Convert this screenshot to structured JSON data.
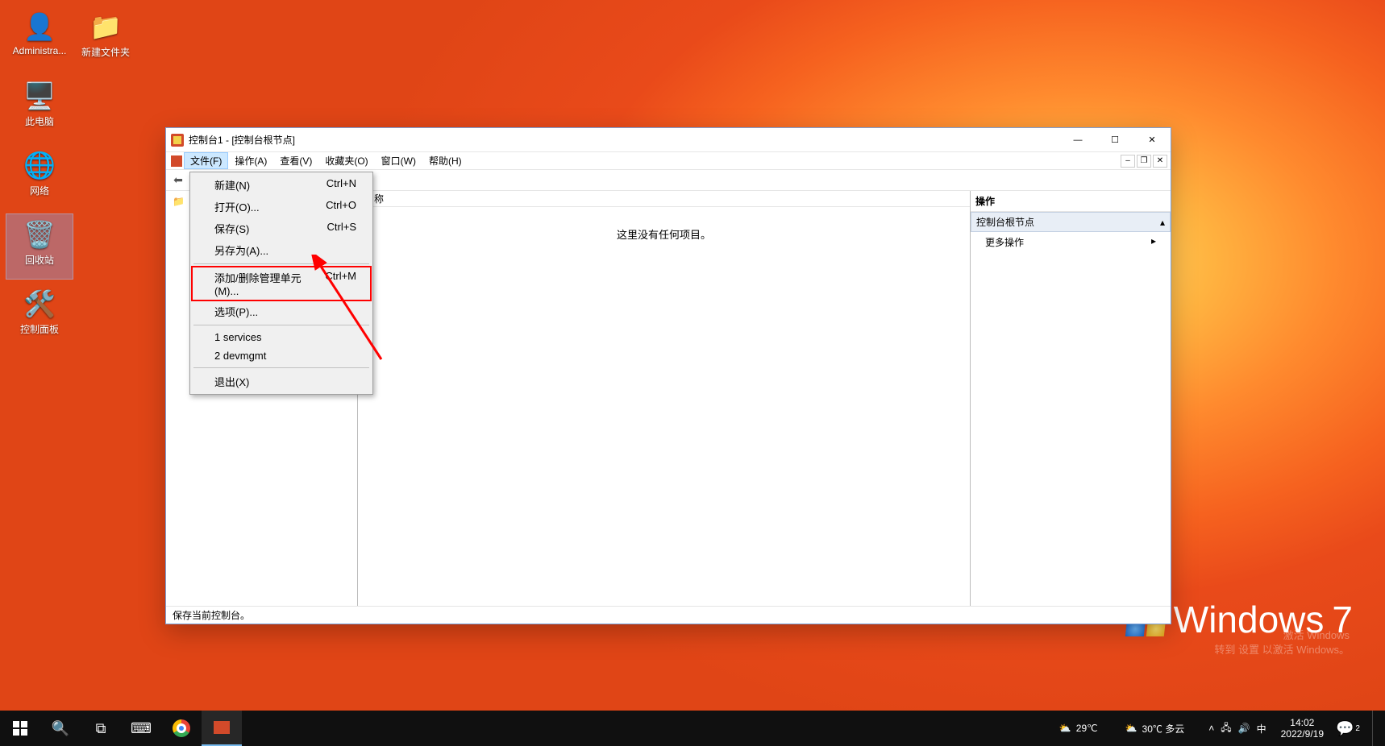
{
  "desktop_icons": {
    "administrator": "Administra...",
    "new_folder": "新建文件夹",
    "this_pc": "此电脑",
    "network": "网络",
    "recycle": "回收站",
    "control_panel": "控制面板"
  },
  "brand": {
    "name": "Windows",
    "ver": "7"
  },
  "watermark": {
    "l1": "激活 Windows",
    "l2": "转到 设置 以激活 Windows。"
  },
  "window": {
    "title": "控制台1 - [控制台根节点]",
    "menus": {
      "file": "文件(F)",
      "action": "操作(A)",
      "view": "查看(V)",
      "fav": "收藏夹(O)",
      "window": "窗口(W)",
      "help": "帮助(H)"
    },
    "content_header": "名称",
    "content_empty": "这里没有任何项目。",
    "actions": {
      "title": "操作",
      "section": "控制台根节点",
      "more": "更多操作"
    },
    "status": "保存当前控制台。"
  },
  "dropdown": {
    "new": {
      "label": "新建(N)",
      "accel": "Ctrl+N"
    },
    "open": {
      "label": "打开(O)...",
      "accel": "Ctrl+O"
    },
    "save": {
      "label": "保存(S)",
      "accel": "Ctrl+S"
    },
    "saveas": {
      "label": "另存为(A)...",
      "accel": ""
    },
    "snapin": {
      "label": "添加/删除管理单元(M)...",
      "accel": "Ctrl+M"
    },
    "options": {
      "label": "选项(P)...",
      "accel": ""
    },
    "recent1": {
      "label": "1 services",
      "accel": ""
    },
    "recent2": {
      "label": "2 devmgmt",
      "accel": ""
    },
    "exit": {
      "label": "退出(X)",
      "accel": ""
    }
  },
  "taskbar": {
    "weather_left": "29℃",
    "weather_right": "30℃ 多云",
    "ime": "中",
    "time": "14:02",
    "date": "2022/9/19",
    "notif": "2"
  }
}
